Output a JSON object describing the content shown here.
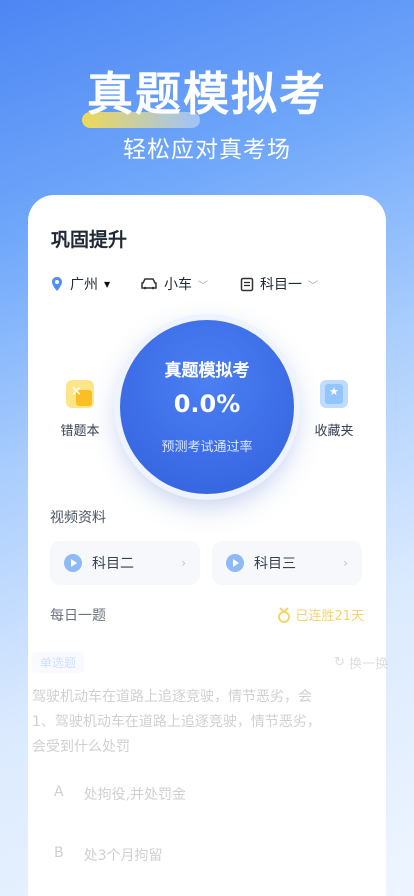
{
  "hero": {
    "title": "真题模拟考",
    "subtitle": "轻松应对真考场"
  },
  "card": {
    "title": "巩固提升",
    "filters": [
      {
        "label": "广州",
        "icon": "location-pin-icon"
      },
      {
        "label": "小车",
        "icon": "car-icon"
      },
      {
        "label": "科目一",
        "icon": "document-icon"
      }
    ],
    "exam": {
      "title": "真题模拟考",
      "value": "0.0%",
      "subtitle": "预测考试通过率"
    },
    "side_left": {
      "label": "错题本",
      "icon": "wrong-book-icon"
    },
    "side_right": {
      "label": "收藏夹",
      "icon": "favorites-icon"
    },
    "video_section_label": "视频资料",
    "videos": [
      {
        "label": "科目二"
      },
      {
        "label": "科目三"
      }
    ],
    "daily": {
      "label": "每日一题",
      "streak": "已连胜21天"
    },
    "question": {
      "badge": "单选题",
      "refresh": "换一换",
      "text": "驾驶机动车在道路上追逐竞驶，情节恶劣，会1、驾驶机动车在道路上追逐竞驶，情节恶劣，会受到什么处罚",
      "options": [
        {
          "letter": "A",
          "text": "处拘役,并处罚金"
        },
        {
          "letter": "B",
          "text": "处3个月拘留"
        }
      ]
    }
  },
  "colors": {
    "accent": "#3d6ee8",
    "streak": "#f4d56a"
  }
}
